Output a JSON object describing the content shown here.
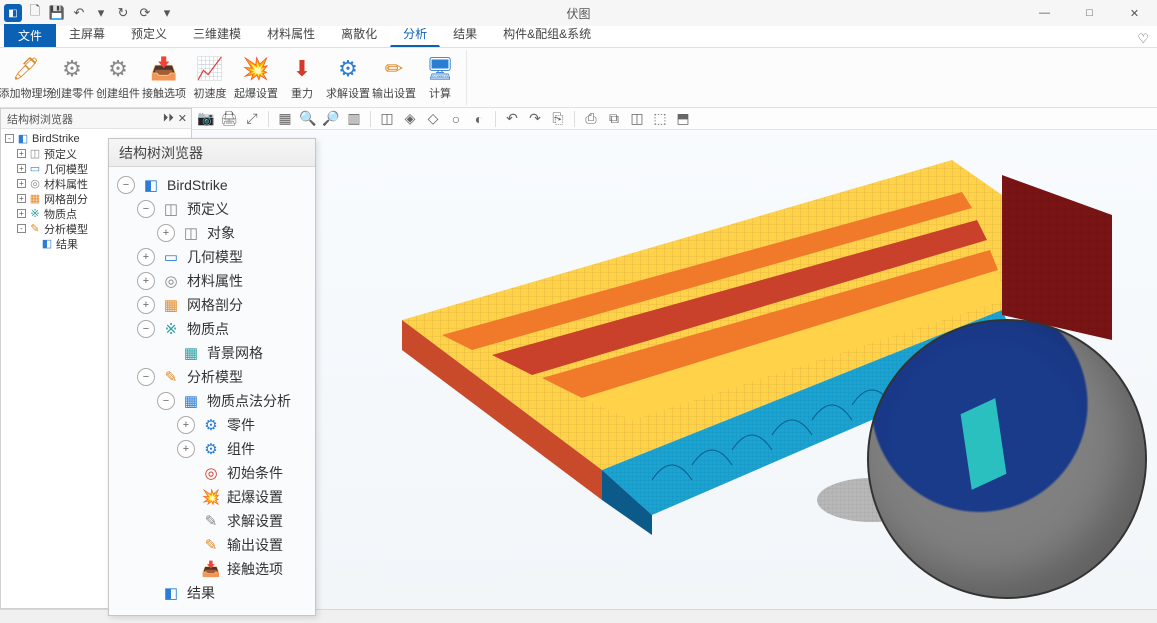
{
  "app": {
    "title": "伏图"
  },
  "qat": [
    "new",
    "save",
    "undo",
    "redo",
    "dropdown",
    "refresh",
    "dropdown2"
  ],
  "window": {
    "min": "—",
    "max": "□",
    "close": "✕"
  },
  "menubar": {
    "file_label": "文件",
    "tabs": [
      "主屏幕",
      "预定义",
      "三维建模",
      "材料属性",
      "离散化",
      "分析",
      "结果",
      "构件&配组&系统"
    ],
    "active_index": 5
  },
  "ribbon": [
    {
      "label": "添加物理场",
      "icon": "🖊",
      "color": "c-orange"
    },
    {
      "label": "创建零件",
      "icon": "⚙",
      "color": "c-gray"
    },
    {
      "label": "创建组件",
      "icon": "⚙",
      "color": "c-gray"
    },
    {
      "label": "接触选项",
      "icon": "📥",
      "color": "c-blue"
    },
    {
      "label": "初速度",
      "icon": "📈",
      "color": "c-blue"
    },
    {
      "label": "起爆设置",
      "icon": "💥",
      "color": "c-orange"
    },
    {
      "label": "重力",
      "icon": "⬇",
      "color": "c-red"
    },
    {
      "label": "求解设置",
      "icon": "⚙",
      "color": "c-blue"
    },
    {
      "label": "输出设置",
      "icon": "✏",
      "color": "c-orange"
    },
    {
      "label": "计算",
      "icon": "🖥",
      "color": "c-blue"
    }
  ],
  "dock": {
    "title": "结构树浏览器",
    "items": [
      {
        "label": "BirdStrike",
        "depth": 0,
        "pm": "-",
        "ic": "◧",
        "cls": "c-blue"
      },
      {
        "label": "预定义",
        "depth": 1,
        "pm": "+",
        "ic": "◫",
        "cls": "c-gray"
      },
      {
        "label": "几何模型",
        "depth": 1,
        "pm": "+",
        "ic": "▭",
        "cls": "c-blue"
      },
      {
        "label": "材料属性",
        "depth": 1,
        "pm": "+",
        "ic": "◎",
        "cls": "c-gray"
      },
      {
        "label": "网格剖分",
        "depth": 1,
        "pm": "+",
        "ic": "▦",
        "cls": "c-orange"
      },
      {
        "label": "物质点",
        "depth": 1,
        "pm": "+",
        "ic": "※",
        "cls": "c-teal"
      },
      {
        "label": "分析模型",
        "depth": 1,
        "pm": "-",
        "ic": "✎",
        "cls": "c-orange"
      },
      {
        "label": "结果",
        "depth": 2,
        "pm": "",
        "ic": "◧",
        "cls": "c-blue"
      }
    ]
  },
  "vtoolbar": [
    "📷",
    "🖨",
    "⤢",
    "▦",
    "🔍",
    "🔎",
    "▥",
    "◫",
    "◈",
    "◇",
    "○",
    "◐",
    "↶",
    "↷",
    "⎘",
    "⎙",
    "⧉",
    "◫",
    "⬚",
    "⬒"
  ],
  "treepanel": {
    "title": "结构树浏览器",
    "rows": [
      {
        "d": 1,
        "toggle": "−",
        "icon": "◧",
        "cls": "c-blue",
        "label": "BirdStrike"
      },
      {
        "d": 2,
        "toggle": "−",
        "icon": "◫",
        "cls": "c-gray",
        "label": "预定义"
      },
      {
        "d": 3,
        "toggle": "+",
        "icon": "◫",
        "cls": "c-gray",
        "label": "对象"
      },
      {
        "d": 2,
        "toggle": "+",
        "icon": "▭",
        "cls": "c-blue",
        "label": "几何模型"
      },
      {
        "d": 2,
        "toggle": "+",
        "icon": "◎",
        "cls": "c-gray",
        "label": "材料属性"
      },
      {
        "d": 2,
        "toggle": "+",
        "icon": "▦",
        "cls": "c-orange",
        "label": "网格剖分"
      },
      {
        "d": 2,
        "toggle": "−",
        "icon": "※",
        "cls": "c-teal",
        "label": "物质点"
      },
      {
        "d": 3,
        "toggle": "",
        "icon": "▦",
        "cls": "c-teal",
        "label": "背景网格"
      },
      {
        "d": 2,
        "toggle": "−",
        "icon": "✎",
        "cls": "c-orange",
        "label": "分析模型"
      },
      {
        "d": 3,
        "toggle": "−",
        "icon": "▦",
        "cls": "c-blue",
        "label": "物质点法分析"
      },
      {
        "d": 4,
        "toggle": "+",
        "icon": "⚙",
        "cls": "c-blue",
        "label": "零件"
      },
      {
        "d": 4,
        "toggle": "+",
        "icon": "⚙",
        "cls": "c-blue",
        "label": "组件"
      },
      {
        "d": 4,
        "toggle": "",
        "icon": "◎",
        "cls": "c-red",
        "label": "初始条件"
      },
      {
        "d": 4,
        "toggle": "",
        "icon": "💥",
        "cls": "c-orange",
        "label": "起爆设置"
      },
      {
        "d": 4,
        "toggle": "",
        "icon": "✎",
        "cls": "c-gray",
        "label": "求解设置"
      },
      {
        "d": 4,
        "toggle": "",
        "icon": "✎",
        "cls": "c-orange",
        "label": "输出设置"
      },
      {
        "d": 4,
        "toggle": "",
        "icon": "📥",
        "cls": "c-blue",
        "label": "接触选项"
      },
      {
        "d": 2,
        "toggle": "",
        "icon": "◧",
        "cls": "c-blue",
        "label": "结果"
      }
    ]
  }
}
